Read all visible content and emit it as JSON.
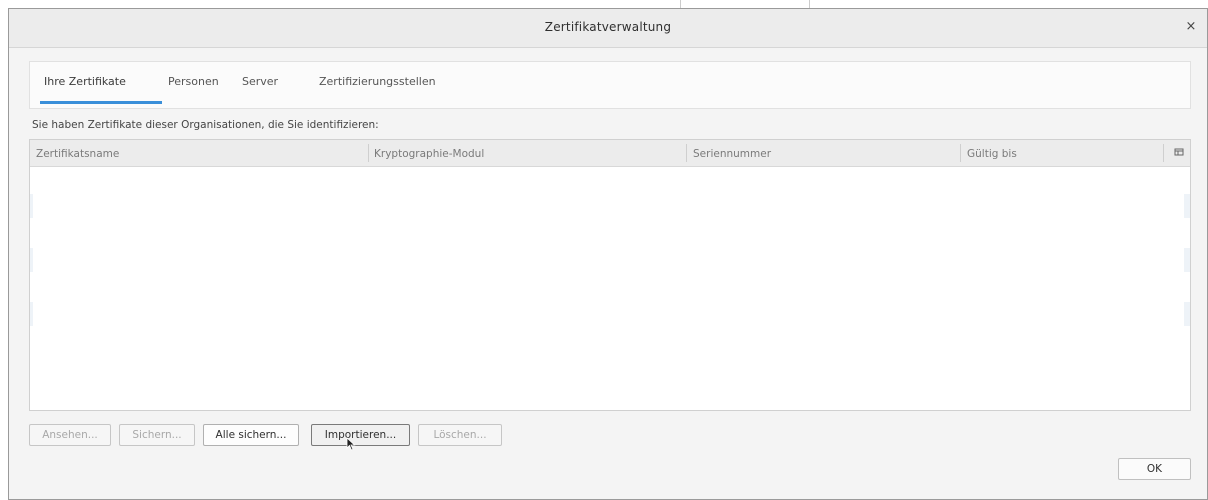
{
  "dialog": {
    "title": "Zertifikatverwaltung",
    "close_glyph": "×"
  },
  "tabs": [
    {
      "label": "Ihre Zertifikate",
      "selected": true
    },
    {
      "label": "Personen",
      "selected": false
    },
    {
      "label": "Server",
      "selected": false
    },
    {
      "label": "Zertifizierungsstellen",
      "selected": false
    }
  ],
  "description": "Sie haben Zertifikate dieser Organisationen, die Sie identifizieren:",
  "table": {
    "columns": [
      "Zertifikatsname",
      "Kryptographie-Modul",
      "Seriennummer",
      "Gültig bis"
    ],
    "rows": []
  },
  "buttons": {
    "view": "Ansehen...",
    "backup": "Sichern...",
    "backup_all": "Alle sichern...",
    "import": "Importieren...",
    "delete": "Löschen...",
    "ok": "OK"
  },
  "colors": {
    "accent": "#3a8fd9",
    "dialog_bg": "#f4f4f4",
    "disabled_text": "#a8a8a8"
  }
}
